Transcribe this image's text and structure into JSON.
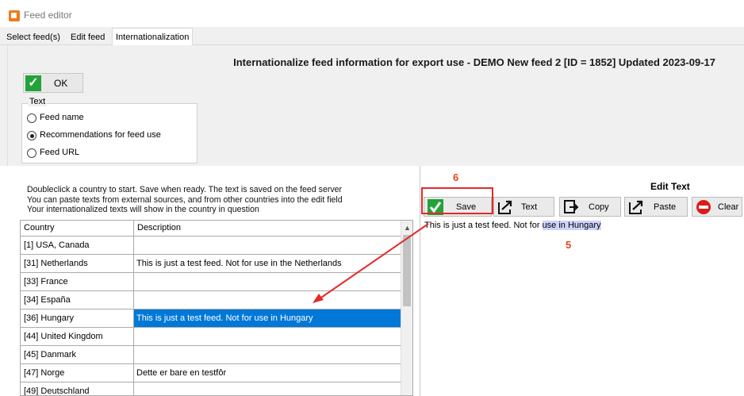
{
  "window": {
    "title": "Feed editor",
    "icon": "app-icon"
  },
  "tabs": [
    {
      "label": "Select feed(s)",
      "active": false
    },
    {
      "label": "Edit feed",
      "active": false
    },
    {
      "label": "Internationalization",
      "active": true
    }
  ],
  "header": {
    "heading": "Internationalize feed information for export use - DEMO New feed 2 [ID = 1852] Updated 2023-09-17"
  },
  "ok_button": {
    "label": "OK",
    "icon": "check-icon"
  },
  "text_group": {
    "title": "Text",
    "options": [
      {
        "label": "Feed name",
        "selected": false
      },
      {
        "label": "Recommendations for feed use",
        "selected": true
      },
      {
        "label": "Feed URL",
        "selected": false
      }
    ]
  },
  "instructions": "Doubleclick a country to start. Save when ready. The text is saved on the feed server\nYou can paste texts from external sources, and from other countries into the edit field\nYour internationalized texts will show in the country in question",
  "grid": {
    "columns": [
      "Country",
      "Description"
    ],
    "rows": [
      {
        "country": "[1] USA, Canada",
        "description": "",
        "selected": false
      },
      {
        "country": "[31] Netherlands",
        "description": "This is just a test feed. Not for use in the Netherlands",
        "selected": false
      },
      {
        "country": "[33] France",
        "description": "",
        "selected": false
      },
      {
        "country": "[34] España",
        "description": "",
        "selected": false
      },
      {
        "country": "[36] Hungary",
        "description": "This is just a test feed. Not for use in Hungary",
        "selected": true
      },
      {
        "country": "[44] United Kingdom",
        "description": "",
        "selected": false
      },
      {
        "country": "[45] Danmark",
        "description": "",
        "selected": false
      },
      {
        "country": "[47] Norge",
        "description": "Dette er bare en testfôr",
        "selected": false
      },
      {
        "country": "[49] Deutschland",
        "description": "",
        "selected": false
      }
    ]
  },
  "edit_panel": {
    "title": "Edit Text",
    "buttons": [
      {
        "label": "Save",
        "icon": "save-check-icon"
      },
      {
        "label": "Text",
        "icon": "text-arrow-icon"
      },
      {
        "label": "Copy",
        "icon": "copy-icon"
      },
      {
        "label": "Paste",
        "icon": "paste-arrow-icon"
      },
      {
        "label": "Clear",
        "icon": "clear-icon"
      }
    ],
    "text_before": "This is just a test feed. Not for ",
    "text_highlight": "use in Hungary"
  },
  "annotations": {
    "num_6": "6",
    "num_5": "5",
    "color": "#e8431a"
  },
  "colors": {
    "selection": "#0078d7",
    "accent_green": "#22a33a",
    "annotation_red": "#e32a2a"
  }
}
